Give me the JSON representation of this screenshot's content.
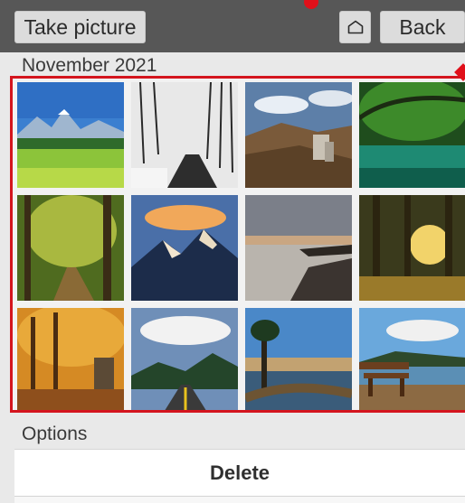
{
  "toolbar": {
    "take_picture_label": "Take picture",
    "back_label": "Back",
    "home_icon": "home-icon"
  },
  "gallery": {
    "month_label": "November 2021",
    "photos": [
      "meadow-mountains",
      "snowy-forest-road",
      "stone-ruin-hills",
      "forest-lake",
      "forest-path",
      "snowy-peaks-sunset",
      "rocky-shore-dusk",
      "sunlit-forest",
      "autumn-forest-ruin",
      "road-into-mountains",
      "lone-tree-lake",
      "bench-by-lake"
    ]
  },
  "options": {
    "title": "Options",
    "delete_label": "Delete"
  },
  "colors": {
    "topbar": "#575757",
    "highlight": "#d4151e",
    "background": "#e9e9e9"
  }
}
